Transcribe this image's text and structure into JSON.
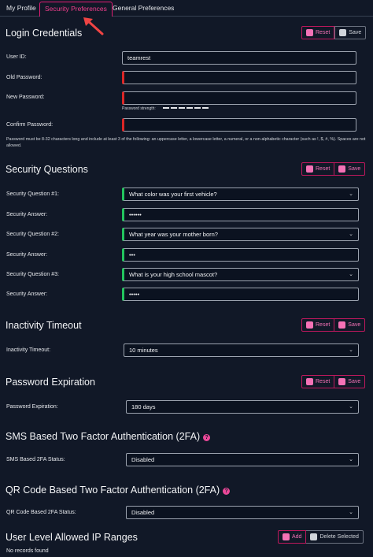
{
  "tabs": [
    "My Profile",
    "Security Preferences",
    "General Preferences"
  ],
  "buttons": {
    "reset": "Reset",
    "save": "Save",
    "add": "Add",
    "delete_selected": "Delete Selected"
  },
  "login": {
    "title": "Login Credentials",
    "user_id_label": "User ID:",
    "user_id_value": "teamrest",
    "old_password_label": "Old Password:",
    "new_password_label": "New Password:",
    "strength_label": "Password strength:",
    "confirm_password_label": "Confirm Password:",
    "hint": "Password must be 8-32 characters long and include at least 3 of the following: an uppercase letter, a lowercase letter, a numeral, or a non-alphabetic character (such as !, $, #, %). Spaces are not allowed."
  },
  "security_questions": {
    "title": "Security Questions",
    "items": [
      {
        "q_label": "Security Question #1:",
        "question": "What color was your first vehicle?",
        "a_label": "Security Answer:",
        "answer": "••••••"
      },
      {
        "q_label": "Security Question #2:",
        "question": "What year was your mother born?",
        "a_label": "Security Answer:",
        "answer": "•••"
      },
      {
        "q_label": "Security Question #3:",
        "question": "What is your high school mascot?",
        "a_label": "Security Answer:",
        "answer": "•••••"
      }
    ]
  },
  "inactivity": {
    "title": "Inactivity Timeout",
    "label": "Inactivity Timeout:",
    "value": "10 minutes"
  },
  "expiration": {
    "title": "Password Expiration",
    "label": "Password Expiration:",
    "value": "180 days"
  },
  "sms_2fa": {
    "title": "SMS Based Two Factor Authentication (2FA)",
    "label": "SMS Based 2FA Status:",
    "value": "Disabled"
  },
  "qr_2fa": {
    "title": "QR Code Based Two Factor Authentication (2FA)",
    "label": "QR Code Based 2FA Status:",
    "value": "Disabled"
  },
  "ip_ranges": {
    "title": "User Level Allowed IP Ranges",
    "empty": "No records found"
  },
  "colors": {
    "accent": "#ec4899",
    "error": "#dc2626",
    "valid": "#22c55e",
    "background": "#111827"
  }
}
